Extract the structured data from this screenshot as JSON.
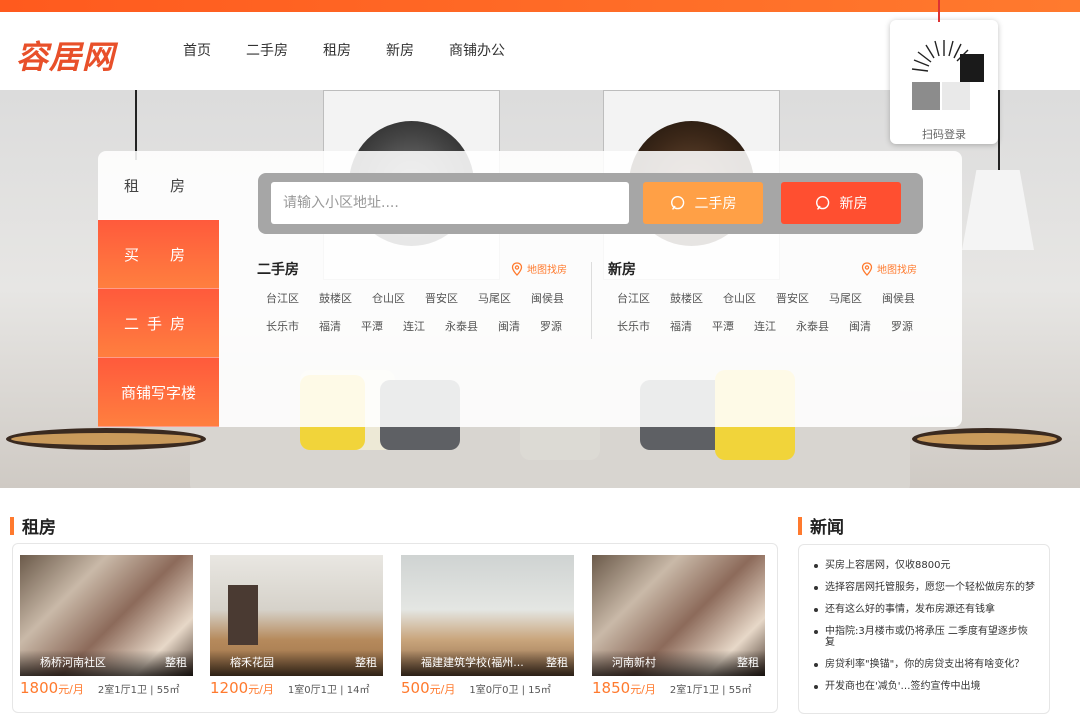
{
  "brand": {
    "logo": "容居网",
    "accent": "#ff7a2e"
  },
  "nav": {
    "items": [
      "首页",
      "二手房",
      "租房",
      "新房",
      "商铺办公"
    ]
  },
  "qr": {
    "label": "扫码登录"
  },
  "tabs": [
    "租　房",
    "买　房",
    "二手房",
    "商铺写字楼"
  ],
  "search": {
    "placeholder": "请输入小区地址....",
    "btn_secondhand": "二手房",
    "btn_new": "新房"
  },
  "columns": {
    "secondhand": {
      "title": "二手房",
      "map_link": "地图找房",
      "row1": [
        "台江区",
        "鼓楼区",
        "仓山区",
        "晋安区",
        "马尾区",
        "闽侯县"
      ],
      "row2": [
        "长乐市",
        "福清",
        "平潭",
        "连江",
        "永泰县",
        "闽清",
        "罗源"
      ]
    },
    "newhome": {
      "title": "新房",
      "map_link": "地图找房",
      "row1": [
        "台江区",
        "鼓楼区",
        "仓山区",
        "晋安区",
        "马尾区",
        "闽侯县"
      ],
      "row2": [
        "长乐市",
        "福清",
        "平潭",
        "连江",
        "永泰县",
        "闽清",
        "罗源"
      ]
    }
  },
  "rent": {
    "title": "租房",
    "cards": [
      {
        "name": "杨桥河南社区",
        "tag": "整租",
        "price": "1800",
        "unit": "元/月",
        "spec": "2室1厅1卫 | 55㎡"
      },
      {
        "name": "榕禾花园",
        "tag": "整租",
        "price": "1200",
        "unit": "元/月",
        "spec": "1室0厅1卫 | 14㎡"
      },
      {
        "name": "福建建筑学校(福州...",
        "tag": "整租",
        "price": "500",
        "unit": "元/月",
        "spec": "1室0厅0卫 | 15㎡"
      },
      {
        "name": "河南新村",
        "tag": "整租",
        "price": "1850",
        "unit": "元/月",
        "spec": "2室1厅1卫 | 55㎡"
      }
    ]
  },
  "news": {
    "title": "新闻",
    "items": [
      "买房上容居网，仅收8800元",
      "选择容居网托管服务，愿您一个轻松做房东的梦",
      "还有这么好的事情，发布房源还有钱拿",
      "中指院:3月楼市或仍将承压 二季度有望逐步恢复",
      "房贷利率\"换锚\"，你的房贷支出将有啥变化？",
      "开发商也在'减负'…签约宣传中出境"
    ]
  }
}
